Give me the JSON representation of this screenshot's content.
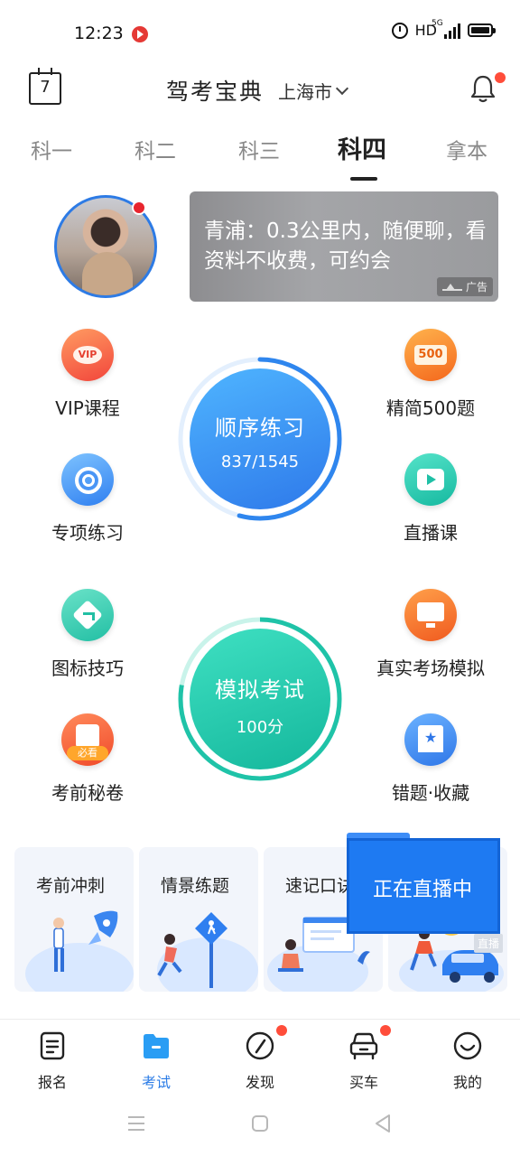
{
  "status_bar": {
    "time": "12:23",
    "hd": "HD",
    "network": "5G"
  },
  "header": {
    "calendar_day": "7",
    "title": "驾考宝典",
    "city": "上海市"
  },
  "tabs": [
    {
      "label": "科一",
      "active": false
    },
    {
      "label": "科二",
      "active": false
    },
    {
      "label": "科三",
      "active": false
    },
    {
      "label": "科四",
      "active": true
    },
    {
      "label": "拿本",
      "active": false
    }
  ],
  "ad": {
    "text": "青浦：0.3公里内，随便聊，看资料不收费，可约会",
    "badge": "广告"
  },
  "features": {
    "vip": "VIP课程",
    "five_hundred": "精简500题",
    "special": "专项练习",
    "live_class": "直播课",
    "sign_tips": "图标技巧",
    "real_exam": "真实考场模拟",
    "secret": "考前秘卷",
    "secret_tag": "必看",
    "mistakes": "错题·收藏"
  },
  "sequence_practice": {
    "title": "顺序练习",
    "progress_text": "837/1545",
    "done": 837,
    "total": 1545
  },
  "mock_exam": {
    "title": "模拟考试",
    "score": "100分"
  },
  "cards": [
    {
      "label": "考前冲刺"
    },
    {
      "label": "情景练题"
    },
    {
      "label": "速记口诀"
    }
  ],
  "live_banner": {
    "text": "正在直播中",
    "tag": "直播"
  },
  "bottom_nav": [
    {
      "label": "报名",
      "active": false
    },
    {
      "label": "考试",
      "active": true
    },
    {
      "label": "发现",
      "active": false
    },
    {
      "label": "买车",
      "active": false
    },
    {
      "label": "我的",
      "active": false
    }
  ],
  "colors": {
    "accent_blue": "#2a7be6",
    "accent_teal": "#1fc3a8",
    "notify_red": "#ff4d3a"
  }
}
